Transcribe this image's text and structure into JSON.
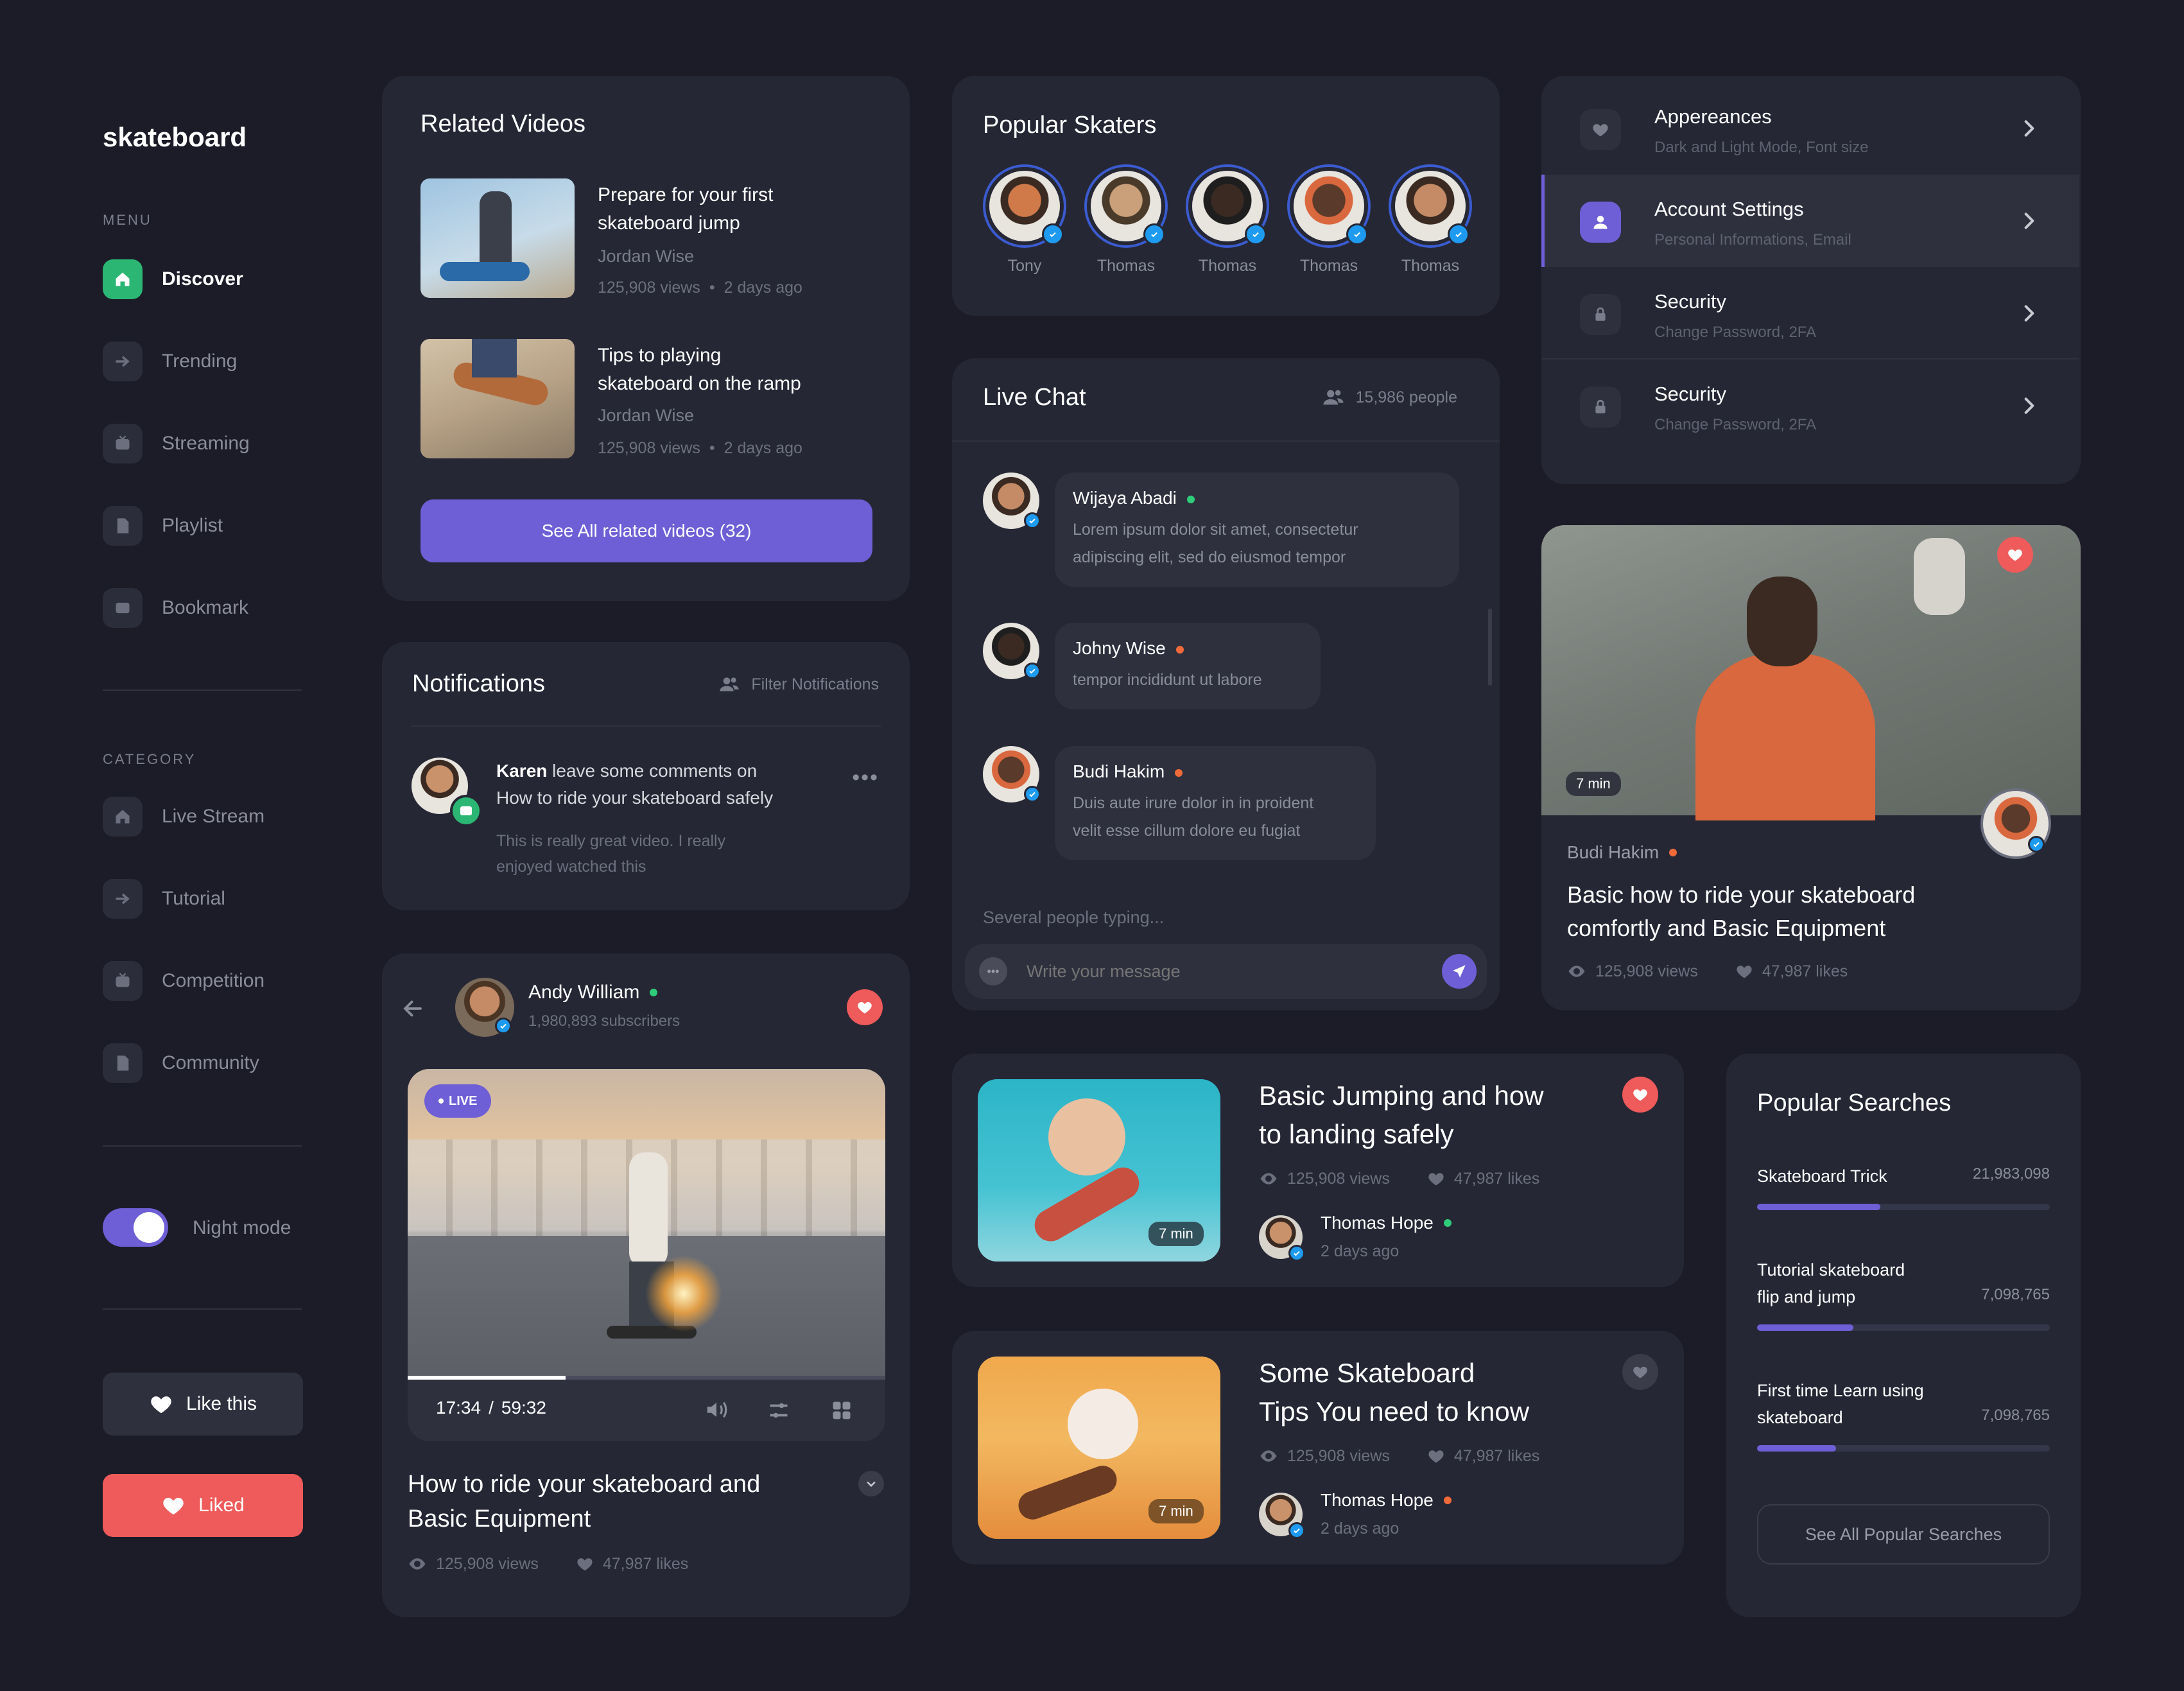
{
  "brand": "skateboard",
  "sidebar": {
    "menu_label": "MENU",
    "menu_items": [
      {
        "label": "Discover",
        "icon": "home-icon"
      },
      {
        "label": "Trending",
        "icon": "arrow-icon"
      },
      {
        "label": "Streaming",
        "icon": "video-icon"
      },
      {
        "label": "Playlist",
        "icon": "file-icon"
      },
      {
        "label": "Bookmark",
        "icon": "wallet-icon"
      }
    ],
    "category_label": "CATEGORY",
    "category_items": [
      {
        "label": "Live Stream",
        "icon": "home-icon"
      },
      {
        "label": "Tutorial",
        "icon": "arrow-icon"
      },
      {
        "label": "Competition",
        "icon": "video-icon"
      },
      {
        "label": "Community",
        "icon": "file-icon"
      }
    ],
    "night_mode_label": "Night mode",
    "night_mode_on": true,
    "like_button": "Like this",
    "liked_button": "Liked"
  },
  "related": {
    "title": "Related Videos",
    "videos": [
      {
        "title_line1": "Prepare for your first",
        "title_line2": "skateboard jump",
        "author": "Jordan Wise",
        "views": "125,908 views",
        "age": "2 days ago"
      },
      {
        "title_line1": "Tips to playing",
        "title_line2": "skateboard on the ramp",
        "author": "Jordan Wise",
        "views": "125,908 views",
        "age": "2 days ago"
      }
    ],
    "see_all": "See All related videos (32)"
  },
  "notifications": {
    "title": "Notifications",
    "filter": "Filter Notifications",
    "item": {
      "name": "Karen",
      "action": " leave some comments on",
      "line2": "How to ride your skateboard safely",
      "body1": "This is really great video. I really",
      "body2": "enjoyed watched this"
    }
  },
  "player": {
    "channel": "Andy William",
    "subscribers": "1,980,893 subscribers",
    "live": "LIVE",
    "time": "17:34",
    "sep": "/",
    "duration": "59:32",
    "progress": 0.33,
    "title_line1": "How to ride your skateboard and",
    "title_line2": "Basic Equipment",
    "views": "125,908 views",
    "likes": "47,987 likes"
  },
  "skaters": {
    "title": "Popular Skaters",
    "names": [
      "Tony",
      "Thomas",
      "Thomas",
      "Thomas",
      "Thomas"
    ]
  },
  "chat": {
    "title": "Live Chat",
    "people": "15,986 people",
    "messages": [
      {
        "name": "Wijaya Abadi",
        "status": "green",
        "line1": "Lorem ipsum dolor sit amet, consectetur",
        "line2": "adipiscing elit, sed do eiusmod tempor"
      },
      {
        "name": "Johny Wise",
        "status": "orange",
        "line1": "tempor incididunt ut labore",
        "line2": ""
      },
      {
        "name": "Budi Hakim",
        "status": "orange",
        "line1": "Duis aute irure dolor in in proident",
        "line2": "velit esse cillum dolore eu fugiat"
      }
    ],
    "typing": "Several people typing...",
    "placeholder": "Write your message"
  },
  "settings": {
    "rows": [
      {
        "title": "Appereances",
        "sub": "Dark and Light Mode, Font size",
        "icon": "heart-icon"
      },
      {
        "title": "Account Settings",
        "sub": "Personal Informations, Email",
        "icon": "user-icon"
      },
      {
        "title": "Security",
        "sub": "Change Password, 2FA",
        "icon": "lock-icon"
      },
      {
        "title": "Security",
        "sub": "Change Password, 2FA",
        "icon": "lock-icon"
      }
    ]
  },
  "featured": {
    "duration": "7 min",
    "author": "Budi Hakim",
    "title_line1": "Basic how to ride your skateboard",
    "title_line2": "comfortly and Basic Equipment",
    "views": "125,908 views",
    "likes": "47,987 likes"
  },
  "video_cards": [
    {
      "title_line1": "Basic Jumping and how",
      "title_line2": "to landing safely",
      "views": "125,908 views",
      "likes": "47,987 likes",
      "author": "Thomas Hope",
      "age": "2 days ago",
      "duration": "7 min",
      "status": "green",
      "liked": true
    },
    {
      "title_line1": "Some Skateboard",
      "title_line2": "Tips You need to know",
      "views": "125,908 views",
      "likes": "47,987 likes",
      "author": "Thomas Hope",
      "age": "2 days ago",
      "duration": "7 min",
      "status": "orange",
      "liked": false
    }
  ],
  "popular_searches": {
    "title": "Popular Searches",
    "items": [
      {
        "line1": "Skateboard Trick",
        "line2": "",
        "count": "21,983,098",
        "fill": 0.42
      },
      {
        "line1": "Tutorial skateboard",
        "line2": "flip and jump",
        "count": "7,098,765",
        "fill": 0.33
      },
      {
        "line1": "First time Learn using",
        "line2": "skateboard",
        "count": "7,098,765",
        "fill": 0.27
      }
    ],
    "see_all": "See All Popular Searches"
  },
  "colors": {
    "accent": "#6e5fd6",
    "green": "#2bb673",
    "red": "#ef5a5a",
    "bg": "#1c1c28",
    "card": "#252734"
  }
}
